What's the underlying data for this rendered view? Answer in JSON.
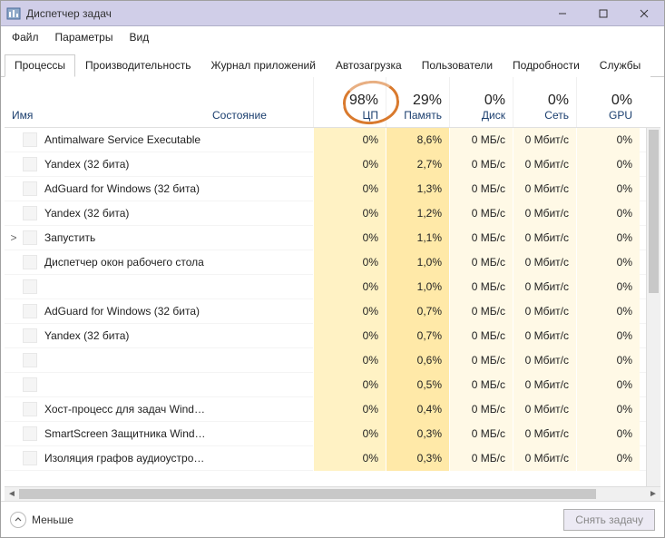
{
  "window": {
    "title": "Диспетчер задач"
  },
  "menu": {
    "file": "Файл",
    "options": "Параметры",
    "view": "Вид"
  },
  "tabs": {
    "processes": "Процессы",
    "performance": "Производительность",
    "apphistory": "Журнал приложений",
    "startup": "Автозагрузка",
    "users": "Пользователи",
    "details": "Подробности",
    "services": "Службы"
  },
  "columns": {
    "name": "Имя",
    "status": "Состояние",
    "cpu": {
      "pct": "98%",
      "label": "ЦП"
    },
    "mem": {
      "pct": "29%",
      "label": "Память"
    },
    "disk": {
      "pct": "0%",
      "label": "Диск"
    },
    "net": {
      "pct": "0%",
      "label": "Сеть"
    },
    "gpu": {
      "pct": "0%",
      "label": "GPU"
    }
  },
  "rows": [
    {
      "name": "Antimalware Service Executable",
      "cpu": "0%",
      "mem": "8,6%",
      "disk": "0 МБ/с",
      "net": "0 Мбит/с",
      "gpu": "0%",
      "expand": ""
    },
    {
      "name": "Yandex (32 бита)",
      "cpu": "0%",
      "mem": "2,7%",
      "disk": "0 МБ/с",
      "net": "0 Мбит/с",
      "gpu": "0%",
      "expand": ""
    },
    {
      "name": "AdGuard for Windows (32 бита)",
      "cpu": "0%",
      "mem": "1,3%",
      "disk": "0 МБ/с",
      "net": "0 Мбит/с",
      "gpu": "0%",
      "expand": ""
    },
    {
      "name": "Yandex (32 бита)",
      "cpu": "0%",
      "mem": "1,2%",
      "disk": "0 МБ/с",
      "net": "0 Мбит/с",
      "gpu": "0%",
      "expand": ""
    },
    {
      "name": "Запустить",
      "cpu": "0%",
      "mem": "1,1%",
      "disk": "0 МБ/с",
      "net": "0 Мбит/с",
      "gpu": "0%",
      "expand": ">"
    },
    {
      "name": "Диспетчер окон рабочего стола",
      "cpu": "0%",
      "mem": "1,0%",
      "disk": "0 МБ/с",
      "net": "0 Мбит/с",
      "gpu": "0%",
      "expand": ""
    },
    {
      "name": "",
      "cpu": "0%",
      "mem": "1,0%",
      "disk": "0 МБ/с",
      "net": "0 Мбит/с",
      "gpu": "0%",
      "expand": ""
    },
    {
      "name": "AdGuard for Windows (32 бита)",
      "cpu": "0%",
      "mem": "0,7%",
      "disk": "0 МБ/с",
      "net": "0 Мбит/с",
      "gpu": "0%",
      "expand": ""
    },
    {
      "name": "Yandex (32 бита)",
      "cpu": "0%",
      "mem": "0,7%",
      "disk": "0 МБ/с",
      "net": "0 Мбит/с",
      "gpu": "0%",
      "expand": ""
    },
    {
      "name": "",
      "cpu": "0%",
      "mem": "0,6%",
      "disk": "0 МБ/с",
      "net": "0 Мбит/с",
      "gpu": "0%",
      "expand": ""
    },
    {
      "name": "",
      "cpu": "0%",
      "mem": "0,5%",
      "disk": "0 МБ/с",
      "net": "0 Мбит/с",
      "gpu": "0%",
      "expand": ""
    },
    {
      "name": "Хост-процесс для задач Windo…",
      "cpu": "0%",
      "mem": "0,4%",
      "disk": "0 МБ/с",
      "net": "0 Мбит/с",
      "gpu": "0%",
      "expand": ""
    },
    {
      "name": "SmartScreen Защитника Windo…",
      "cpu": "0%",
      "mem": "0,3%",
      "disk": "0 МБ/с",
      "net": "0 Мбит/с",
      "gpu": "0%",
      "expand": ""
    },
    {
      "name": "Изоляция графов аудиоустро…",
      "cpu": "0%",
      "mem": "0,3%",
      "disk": "0 МБ/с",
      "net": "0 Мбит/с",
      "gpu": "0%",
      "expand": ""
    }
  ],
  "footer": {
    "less": "Меньше",
    "endtask": "Снять задачу"
  }
}
